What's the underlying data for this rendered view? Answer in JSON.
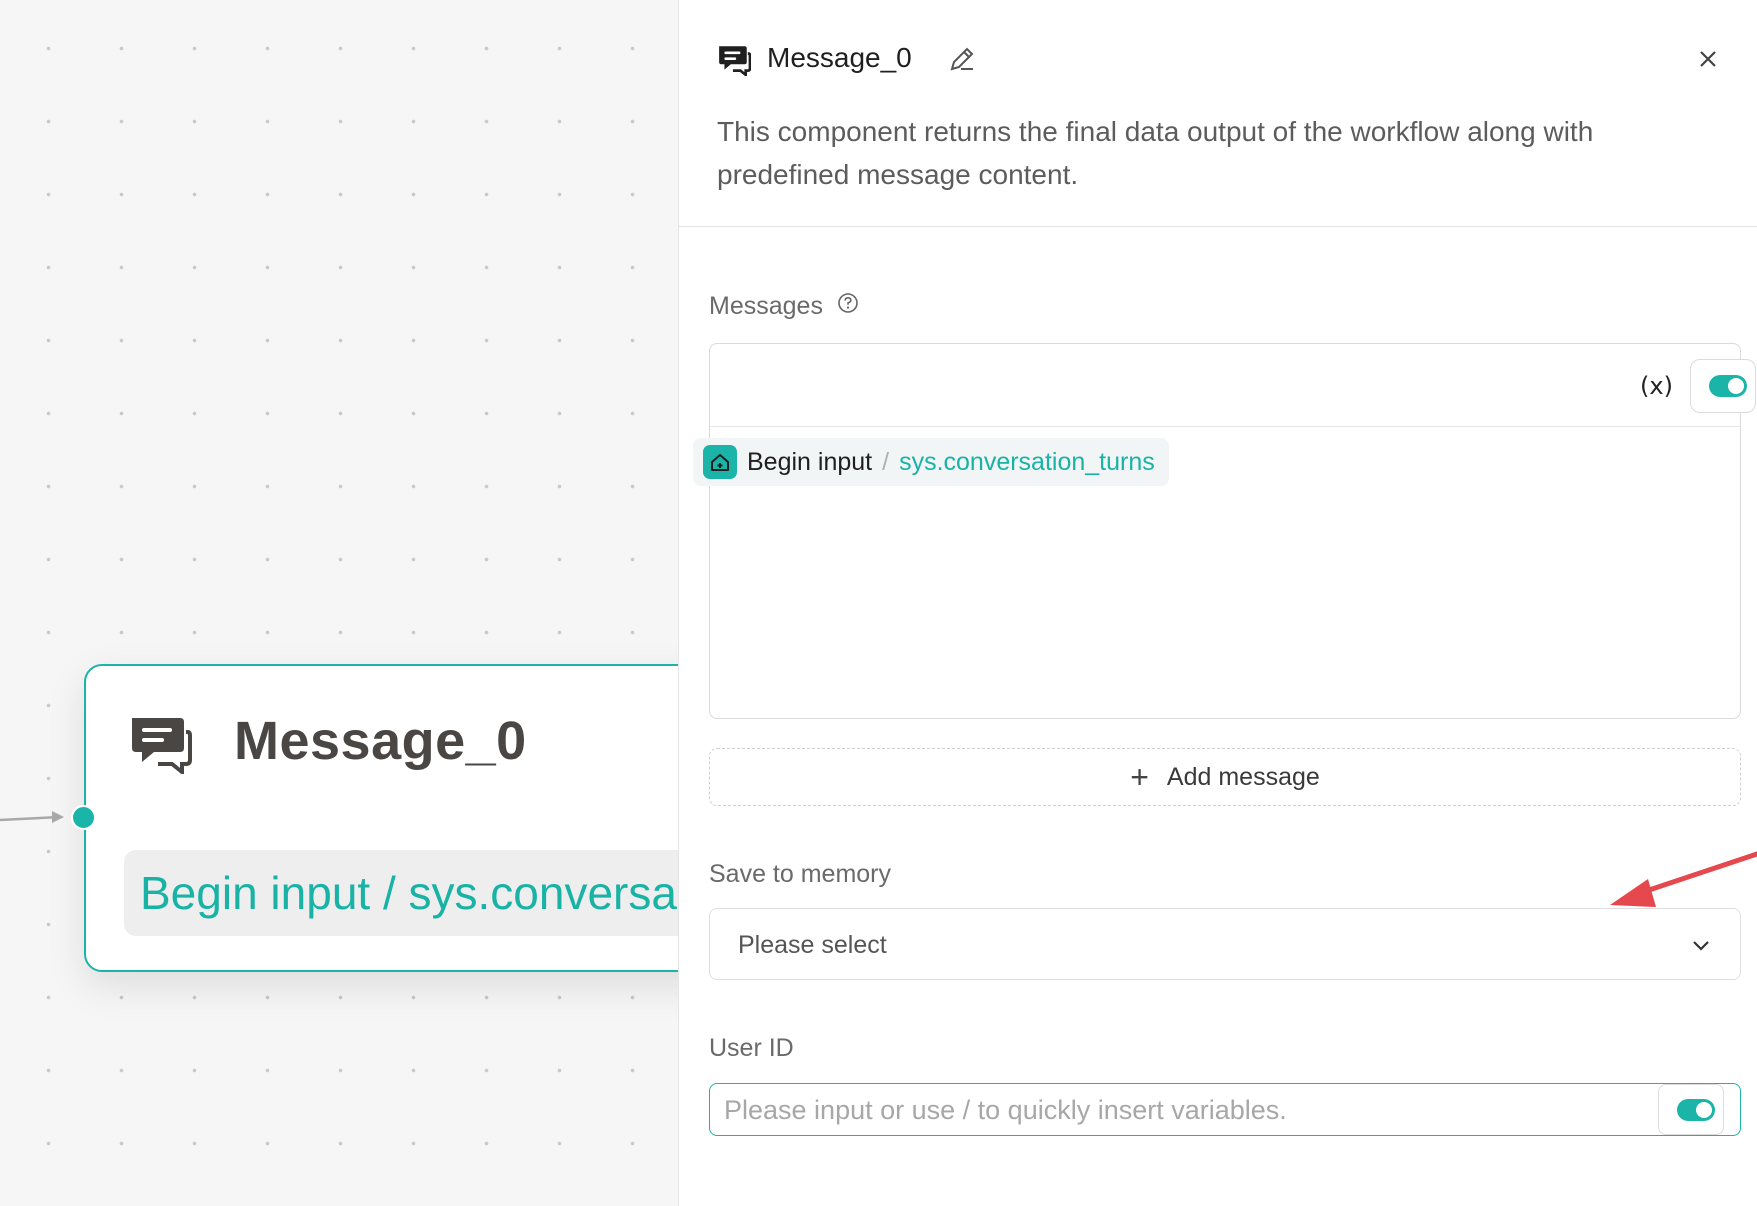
{
  "canvas": {
    "node": {
      "title": "Message_0",
      "content": "Begin input / sys.conversa"
    }
  },
  "panel": {
    "title": "Message_0",
    "description": "This component returns the final data output of the workflow along with predefined message content.",
    "messages": {
      "label": "Messages",
      "var_button": "(x)",
      "items": [
        {
          "source": "Begin input",
          "separator": "/",
          "variable": "sys.conversation_turns"
        }
      ],
      "add_label": "Add message"
    },
    "save_to_memory": {
      "label": "Save to memory",
      "placeholder": "Please select"
    },
    "user_id": {
      "label": "User ID",
      "placeholder": "Please input or use / to quickly insert variables."
    }
  },
  "colors": {
    "accent": "#1ab5a8",
    "annotation_arrow": "#e5484d"
  },
  "icons": [
    "message-icon",
    "edit-icon",
    "close-icon",
    "help-icon",
    "variable-icon",
    "toggle-switch",
    "home-icon",
    "plus-icon",
    "chevron-down-icon",
    "annotation-arrow"
  ]
}
